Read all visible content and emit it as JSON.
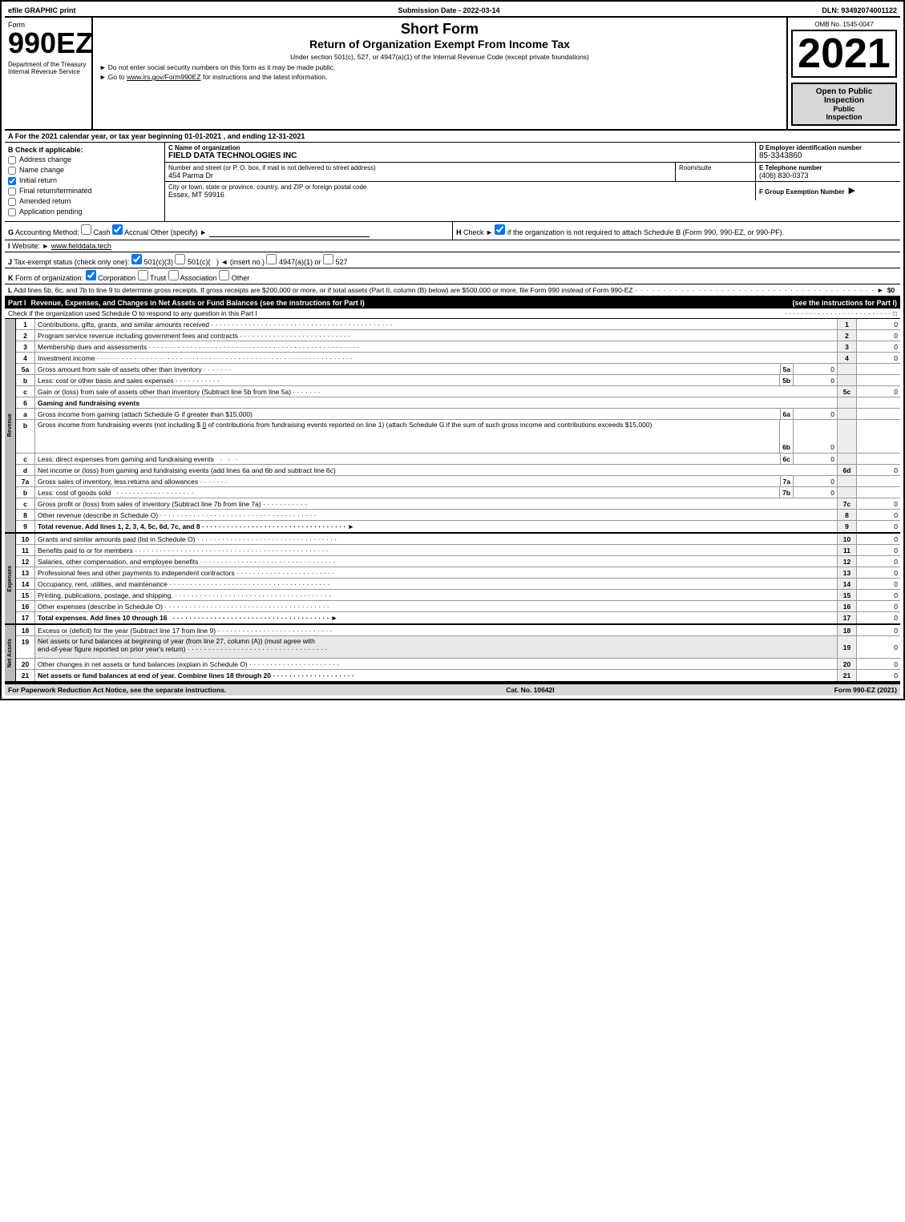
{
  "header": {
    "efile": "efile GRAPHIC print",
    "submission": "Submission Date - 2022-03-14",
    "dln": "DLN: 93492074001122",
    "form_number": "990EZ",
    "dept_label": "Department of the Treasury Internal Revenue Service",
    "short_form": "Short Form",
    "return_title": "Return of Organization Exempt From Income Tax",
    "subtitle": "Under section 501(c), 527, or 4947(a)(1) of the Internal Revenue Code (except private foundations)",
    "notice1": "► Do not enter social security numbers on this form as it may be made public.",
    "notice2": "► Go to www.irs.gov/Form990EZ for instructions and the latest information.",
    "omb": "OMB No. 1545-0047",
    "year": "2021",
    "open_inspection": "Open to Public Inspection"
  },
  "section_a": {
    "label": "A",
    "text": "For the 2021 calendar year, or tax year beginning 01-01-2021 , and ending 12-31-2021"
  },
  "section_b": {
    "label": "B",
    "check_label": "Check if applicable:",
    "checkboxes": [
      {
        "id": "addr_change",
        "label": "Address change",
        "checked": false
      },
      {
        "id": "name_change",
        "label": "Name change",
        "checked": false
      },
      {
        "id": "initial_return",
        "label": "Initial return",
        "checked": true
      },
      {
        "id": "final_return",
        "label": "Final return/terminated",
        "checked": false
      },
      {
        "id": "amended",
        "label": "Amended return",
        "checked": false
      },
      {
        "id": "app_pending",
        "label": "Application pending",
        "checked": false
      }
    ]
  },
  "org_info": {
    "c_label": "C Name of organization",
    "org_name": "FIELD DATA TECHNOLOGIES INC",
    "d_label": "D Employer identification number",
    "ein": "85-3343860",
    "address_label": "Number and street (or P. O. box, if mail is not delivered to street address)",
    "address": "454 Parma Dr",
    "room_label": "Room/suite",
    "room": "",
    "e_label": "E Telephone number",
    "phone": "(406) 830-0373",
    "city_label": "City or town, state or province, country, and ZIP or foreign postal code",
    "city": "Essex, MT  59916",
    "f_label": "F Group Exemption Number",
    "group_num": ""
  },
  "section_g": {
    "label": "G",
    "text": "Accounting Method:",
    "cash": "Cash",
    "accrual": "Accrual",
    "other": "Other (specify) ►",
    "cash_checked": false,
    "accrual_checked": true
  },
  "section_h": {
    "label": "H",
    "text": "Check ►",
    "checked": true,
    "description": "if the organization is not required to attach Schedule B (Form 990, 990-EZ, or 990-PF)."
  },
  "website": {
    "label": "I",
    "text": "Website: ►",
    "url": "www.fielddata.tech"
  },
  "tax_status": {
    "label": "J",
    "text": "Tax-exempt status (check only one):",
    "options": [
      "501(c)(3)",
      "501(c)(",
      ") ◄ (insert no.)",
      "4947(a)(1) or",
      "527"
    ],
    "checked": "501(c)(3)"
  },
  "form_org": {
    "label": "K",
    "text": "Form of organization:",
    "options": [
      "Corporation",
      "Trust",
      "Association",
      "Other"
    ],
    "checked": "Corporation"
  },
  "gross_receipts": {
    "label": "L",
    "text": "Add lines 5b, 6c, and 7b to line 9 to determine gross receipts. If gross receipts are $200,000 or more, or if total assets (Part II, column (B) below) are $500,000 or more, file Form 990 instead of Form 990-EZ",
    "dots": "· · · · · · · · · · · · · · · · · · · · · · · · · · · · · · · · · · · · · · · · · · · · · ►",
    "value": "$0"
  },
  "part1": {
    "title": "Part I",
    "description": "Revenue, Expenses, and Changes in Net Assets or Fund Balances (see the instructions for Part I)",
    "schedule_o_check": "Check if the organization used Schedule O to respond to any question in this Part I",
    "rows": [
      {
        "num": "1",
        "label": "Contributions, gifts, grants, and similar amounts received",
        "line_num": "1",
        "value": "0"
      },
      {
        "num": "2",
        "label": "Program service revenue including government fees and contracts",
        "line_num": "2",
        "value": "0"
      },
      {
        "num": "3",
        "label": "Membership dues and assessments",
        "line_num": "3",
        "value": "0"
      },
      {
        "num": "4",
        "label": "Investment income",
        "line_num": "4",
        "value": "0"
      },
      {
        "num": "5a",
        "label": "Gross amount from sale of assets other than inventory",
        "sub_box": "5a",
        "sub_val": "0",
        "line_num": "",
        "value": ""
      },
      {
        "num": "b",
        "label": "Less: cost or other basis and sales expenses",
        "sub_box": "5b",
        "sub_val": "0",
        "line_num": "",
        "value": ""
      },
      {
        "num": "c",
        "label": "Gain or (loss) from sale of assets other than inventory (Subtract line 5b from line 5a)",
        "line_num": "5c",
        "value": "0"
      },
      {
        "num": "6",
        "label": "Gaming and fundraising events",
        "line_num": "",
        "value": ""
      },
      {
        "num": "a",
        "label": "Gross income from gaming (attach Schedule G if greater than $15,000)",
        "sub_box": "6a",
        "sub_val": "0",
        "line_num": "",
        "value": ""
      },
      {
        "num": "b",
        "label": "Gross income from fundraising events (not including $ 0 of contributions from fundraising events reported on line 1) (attach Schedule G if the sum of such gross income and contributions exceeds $15,000)",
        "sub_box": "6b",
        "sub_val": "0",
        "line_num": "",
        "value": ""
      },
      {
        "num": "c",
        "label": "Less: direct expenses from gaming and fundraising events",
        "sub_box": "6c",
        "sub_val": "0",
        "line_num": "",
        "value": ""
      },
      {
        "num": "d",
        "label": "Net income or (loss) from gaming and fundraising events (add lines 6a and 6b and subtract line 6c)",
        "line_num": "6d",
        "value": "0"
      },
      {
        "num": "7a",
        "label": "Gross sales of inventory, less returns and allowances",
        "sub_box": "7a",
        "sub_val": "0",
        "line_num": "",
        "value": ""
      },
      {
        "num": "b",
        "label": "Less: cost of goods sold",
        "sub_box": "7b",
        "sub_val": "0",
        "line_num": "",
        "value": ""
      },
      {
        "num": "c",
        "label": "Gross profit or (loss) from sales of inventory (Subtract line 7b from line 7a)",
        "line_num": "7c",
        "value": "0"
      },
      {
        "num": "8",
        "label": "Other revenue (describe in Schedule O)",
        "line_num": "8",
        "value": "0"
      },
      {
        "num": "9",
        "label": "Total revenue. Add lines 1, 2, 3, 4, 5c, 6d, 7c, and 8",
        "bold": true,
        "arrow": "►",
        "line_num": "9",
        "value": "0"
      }
    ]
  },
  "expenses_rows": [
    {
      "num": "10",
      "label": "Grants and similar amounts paid (list in Schedule O)",
      "line_num": "10",
      "value": "0"
    },
    {
      "num": "11",
      "label": "Benefits paid to or for members",
      "line_num": "11",
      "value": "0"
    },
    {
      "num": "12",
      "label": "Salaries, other compensation, and employee benefits",
      "line_num": "12",
      "value": "0"
    },
    {
      "num": "13",
      "label": "Professional fees and other payments to independent contractors",
      "line_num": "13",
      "value": "0"
    },
    {
      "num": "14",
      "label": "Occupancy, rent, utilities, and maintenance",
      "line_num": "14",
      "value": "0"
    },
    {
      "num": "15",
      "label": "Printing, publications, postage, and shipping.",
      "line_num": "15",
      "value": "0"
    },
    {
      "num": "16",
      "label": "Other expenses (describe in Schedule O)",
      "line_num": "16",
      "value": "0"
    },
    {
      "num": "17",
      "label": "Total expenses. Add lines 10 through 16",
      "bold": true,
      "arrow": "►",
      "line_num": "17",
      "value": "0"
    }
  ],
  "net_assets_rows": [
    {
      "num": "18",
      "label": "Excess or (deficit) for the year (Subtract line 17 from line 9)",
      "line_num": "18",
      "value": "0"
    },
    {
      "num": "19",
      "label": "Net assets or fund balances at beginning of year (from line 27, column (A)) (must agree with end-of-year figure reported on prior year's return)",
      "line_num": "19",
      "value": "0"
    },
    {
      "num": "20",
      "label": "Other changes in net assets or fund balances (explain in Schedule O)",
      "line_num": "20",
      "value": "0"
    },
    {
      "num": "21",
      "label": "Net assets or fund balances at end of year. Combine lines 18 through 20",
      "bold": true,
      "line_num": "21",
      "value": "0"
    }
  ],
  "footer": {
    "paperwork": "For Paperwork Reduction Act Notice, see the separate instructions.",
    "cat_no": "Cat. No. 10642I",
    "form_ref": "Form 990-EZ (2021)"
  }
}
